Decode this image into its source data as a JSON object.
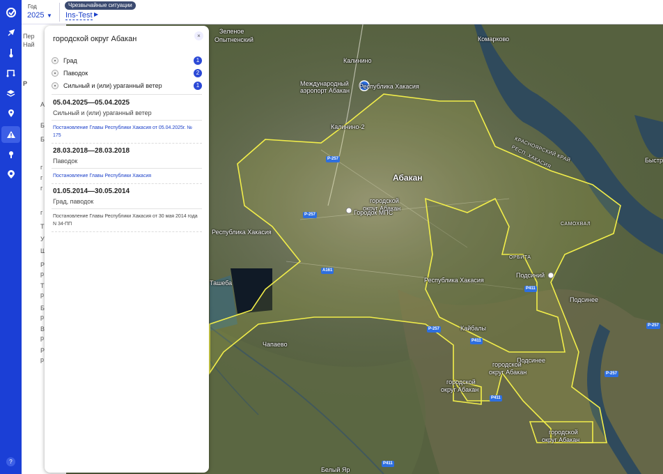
{
  "header": {
    "year_label": "Год",
    "year_value": "2025",
    "category_chip": "Чрезвычайные ситуации",
    "project_link": "Ins-Test"
  },
  "sidebar": {
    "icons": [
      "logo-icon",
      "rocket-icon",
      "thermometer-icon",
      "route-icon",
      "layers-icon",
      "location-pin-icon",
      "warning-icon",
      "point-icon",
      "shield-pin-icon",
      "help-icon"
    ],
    "help_label": "?"
  },
  "underlying_panel": {
    "rows": [
      "Пер",
      "Най",
      "Р",
      "А",
      "Б",
      "Б",
      "г",
      "г",
      "г",
      "г",
      "Т",
      "У",
      "Ш",
      "Р",
      "р",
      "Т",
      "р",
      "Б",
      "р",
      "В",
      "р",
      "Р",
      "р"
    ]
  },
  "popup": {
    "title": "городской округ Абакан",
    "close_label": "×",
    "events": [
      {
        "name": "Град",
        "count": "1"
      },
      {
        "name": "Паводок",
        "count": "2"
      },
      {
        "name": "Сильный и (или) ураганный ветер",
        "count": "1"
      }
    ],
    "records": [
      {
        "period": "05.04.2025—05.04.2025",
        "type": "Сильный и (или) ураганный ветер",
        "document": "Постановление Главы Республики Хакасия от 05.04.2025г. № 175"
      },
      {
        "period": "28.03.2018—28.03.2018",
        "type": "Паводок",
        "document": "Постановление Главы Республики Хакасия"
      },
      {
        "period": "01.05.2014—30.05.2014",
        "type": "Град, паводок",
        "document": "Постановление Главы Республики Хакасия от 30 мая 2014 года N 34-ПП"
      }
    ]
  },
  "map": {
    "labels": [
      "Зеленое",
      "Опытненский",
      "Калинино",
      "Международный",
      "аэропорт Абакан",
      "Республика Хакасия",
      "Комарково",
      "Калинино-2",
      "Абакан",
      "городской",
      "округ Абакан",
      "Городок МПС",
      "Республика Хакасия",
      "Республика Хакасия",
      "Ташеба",
      "Кайбалы",
      "Подсиний",
      "Подсинее",
      "Подсинее",
      "городской",
      "округ Абакан",
      "городской",
      "округ Абакан",
      "городской",
      "округ Абакан",
      "Чапаево",
      "Белый Яр",
      "ОРБИТА",
      "САМОХВАЛ",
      "КРАСНОЯРСКИЙ КРАЙ",
      "РЕСП. ХАКАСИЯ",
      "Быстр",
      "Р-257",
      "Р-257",
      "Р-257",
      "Р-257",
      "Р-257",
      "А161",
      "Р411",
      "Р411",
      "Р411",
      "Р411"
    ],
    "boundary_color": "#f2ee4a",
    "water_color": "#2f4a5c"
  }
}
